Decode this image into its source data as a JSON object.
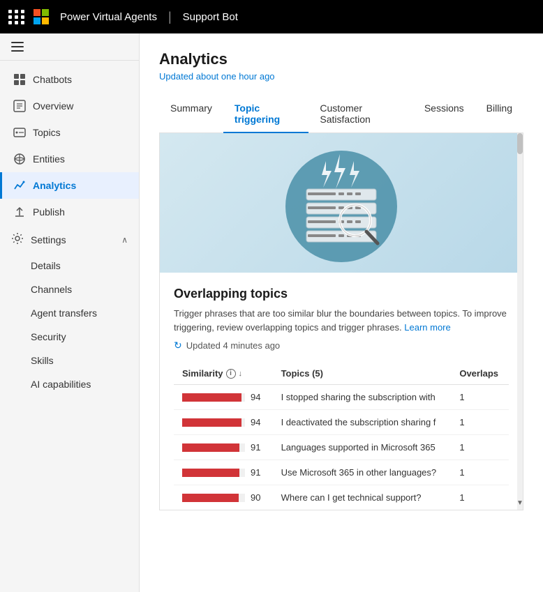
{
  "app": {
    "product": "Power Virtual Agents",
    "bot": "Support Bot",
    "waffle_label": "Apps"
  },
  "sidebar": {
    "hamburger_label": "Menu",
    "items": [
      {
        "id": "chatbots",
        "label": "Chatbots",
        "icon": "⊞"
      },
      {
        "id": "overview",
        "label": "Overview",
        "icon": "□"
      },
      {
        "id": "topics",
        "label": "Topics",
        "icon": "💬"
      },
      {
        "id": "entities",
        "label": "Entities",
        "icon": "⊕"
      },
      {
        "id": "analytics",
        "label": "Analytics",
        "icon": "📈",
        "active": true
      },
      {
        "id": "publish",
        "label": "Publish",
        "icon": "↑"
      }
    ],
    "settings": {
      "label": "Settings",
      "icon": "⚙",
      "expanded": true,
      "subitems": [
        "Details",
        "Channels",
        "Agent transfers",
        "Security",
        "Skills",
        "AI capabilities"
      ]
    }
  },
  "page": {
    "title": "Analytics",
    "updated": "Updated about one hour ago"
  },
  "tabs": [
    {
      "id": "summary",
      "label": "Summary"
    },
    {
      "id": "topic-triggering",
      "label": "Topic triggering",
      "active": true
    },
    {
      "id": "customer-satisfaction",
      "label": "Customer Satisfaction"
    },
    {
      "id": "sessions",
      "label": "Sessions"
    },
    {
      "id": "billing",
      "label": "Billing"
    }
  ],
  "overlapping_topics": {
    "title": "Overlapping topics",
    "description_part1": "Trigger phrases that are too similar blur the boundaries between topics. To improve triggering, review overlapping topics and trigger phrases.",
    "learn_more_label": "Learn more",
    "learn_more_url": "#",
    "updated": "Updated 4 minutes ago",
    "refresh_icon": "↻",
    "table": {
      "headers": [
        {
          "id": "similarity",
          "label": "Similarity",
          "has_info": true,
          "has_sort": true
        },
        {
          "id": "topics",
          "label": "Topics (5)"
        },
        {
          "id": "overlaps",
          "label": "Overlaps"
        }
      ],
      "rows": [
        {
          "similarity": 94,
          "bar_pct": 94,
          "topic": "I stopped sharing the subscription with",
          "overlaps": 1
        },
        {
          "similarity": 94,
          "bar_pct": 94,
          "topic": "I deactivated the subscription sharing f",
          "overlaps": 1
        },
        {
          "similarity": 91,
          "bar_pct": 91,
          "topic": "Languages supported in Microsoft 365",
          "overlaps": 1
        },
        {
          "similarity": 91,
          "bar_pct": 91,
          "topic": "Use Microsoft 365 in other languages?",
          "overlaps": 1
        },
        {
          "similarity": 90,
          "bar_pct": 90,
          "topic": "Where can I get technical support?",
          "overlaps": 1
        }
      ]
    }
  }
}
